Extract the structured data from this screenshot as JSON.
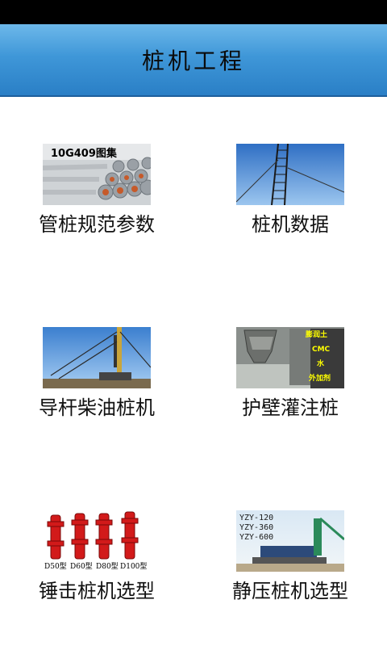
{
  "header": {
    "title": "桩机工程"
  },
  "tiles": [
    {
      "label": "管桩规范参数",
      "thumb_text": "10G409图集"
    },
    {
      "label": "桩机数据"
    },
    {
      "label": "导杆柴油桩机"
    },
    {
      "label": "护壁灌注桩",
      "thumb_text": [
        "膨润土",
        "CMC",
        "水",
        "外加剂"
      ]
    },
    {
      "label": "锤击桩机选型",
      "thumb_text": [
        "D50型",
        "D60型",
        "D80型",
        "D100型"
      ]
    },
    {
      "label": "静压桩机选型",
      "thumb_text": [
        "YZY-120",
        "YZY-360",
        "YZY-600"
      ]
    }
  ]
}
